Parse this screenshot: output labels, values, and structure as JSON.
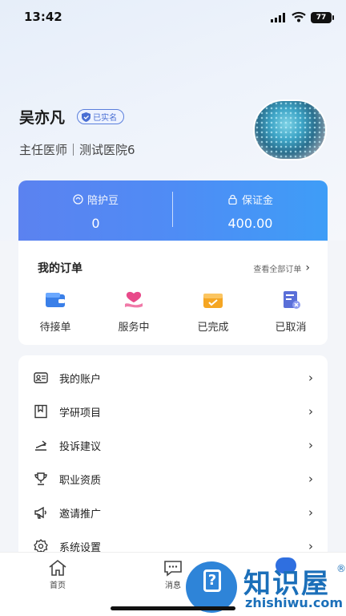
{
  "status_bar": {
    "time": "13:42",
    "battery": "77"
  },
  "profile": {
    "name": "吴亦凡",
    "verified_badge": "已实名",
    "title": "主任医师｜测试医院6"
  },
  "balance": {
    "items": [
      {
        "label": "陪护豆",
        "value": "0",
        "icon": "coin-icon"
      },
      {
        "label": "保证金",
        "value": "400.00",
        "icon": "lock-icon"
      }
    ]
  },
  "orders": {
    "heading": "我的订单",
    "view_all": "查看全部订单",
    "items": [
      {
        "label": "待接单",
        "icon": "wallet-icon",
        "color": "#3a7fe8"
      },
      {
        "label": "服务中",
        "icon": "heart-hand-icon",
        "color": "#e84a8a"
      },
      {
        "label": "已完成",
        "icon": "box-check-icon",
        "color": "#f5a623"
      },
      {
        "label": "已取消",
        "icon": "doc-cancel-icon",
        "color": "#5a6fd8"
      }
    ]
  },
  "menu": {
    "items": [
      {
        "label": "我的账户",
        "icon": "account-icon"
      },
      {
        "label": "学研项目",
        "icon": "bookmark-icon"
      },
      {
        "label": "投诉建议",
        "icon": "feedback-icon"
      },
      {
        "label": "职业资质",
        "icon": "trophy-icon"
      },
      {
        "label": "邀请推广",
        "icon": "megaphone-icon"
      },
      {
        "label": "系统设置",
        "icon": "gear-icon"
      }
    ]
  },
  "tabbar": {
    "items": [
      {
        "label": "首页",
        "icon": "home-icon"
      },
      {
        "label": "消息",
        "icon": "message-icon"
      }
    ]
  },
  "watermark": {
    "brand": "知识屋",
    "domain": "zhishiwu.com"
  }
}
